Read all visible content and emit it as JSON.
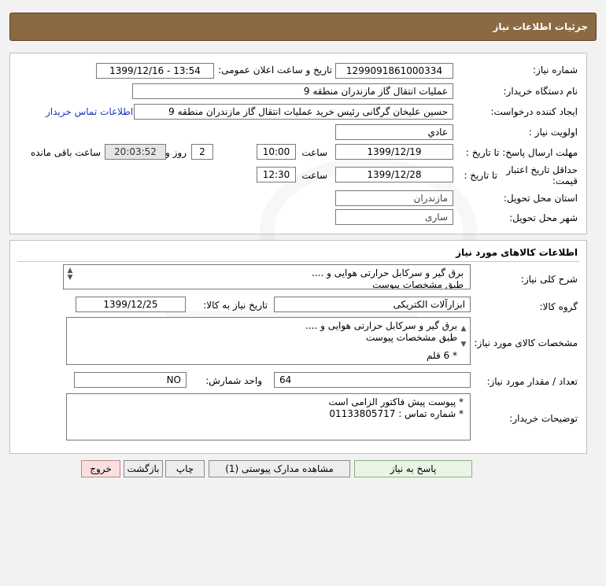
{
  "header": {
    "title": "جزئیات اطلاعات نیاز"
  },
  "fields": {
    "need_number_label": "شماره نیاز:",
    "need_number": "1299091861000334",
    "announce_label": "تاریخ و ساعت اعلان عمومی:",
    "announce_value": "1399/12/16 - 13:54",
    "buyer_org_label": "نام دستگاه خریدار:",
    "buyer_org": "عملیات انتقال گاز مازندران منطقه 9",
    "requester_label": "ایجاد کننده درخواست:",
    "requester": "حسین علیخان گرگانی رئیس خرید عملیات انتقال گاز مازندران منطقه 9",
    "contact_link": "اطلاعات تماس خریدار",
    "priority_label": "اولویت نیاز :",
    "priority": "عادي",
    "deadline_label": "مهلت ارسال پاسخ: تا تاریخ :",
    "deadline_date": "1399/12/19",
    "time_label": "ساعت",
    "deadline_time": "10:00",
    "days_value": "2",
    "days_label": "روز و",
    "remaining_time": "20:03:52",
    "remaining_label": "ساعت باقی مانده",
    "validity_label": "حداقل تاریخ اعتبار قیمت:",
    "validity_until_label": "تا تاریخ :",
    "validity_date": "1399/12/28",
    "validity_time_label": "ساعت",
    "validity_time": "12:30",
    "province_label": "استان محل تحویل:",
    "province": "مازندران",
    "city_label": "شهر محل تحویل:",
    "city": "ساری"
  },
  "goods": {
    "section_title": "اطلاعات کالاهای مورد نیاز",
    "summary_label": "شرح کلی نیاز:",
    "summary_line1": "برق گیر و سرکابل حرارتی هوایی و ....",
    "summary_line2": "طبق مشخصات پیوست",
    "group_label": "گروه کالا:",
    "group_value": "ابزارآلات الکتریکی",
    "need_date_label": "تاریخ نیاز به کالا:",
    "need_date": "1399/12/25",
    "specs_label": "مشخصات کالای مورد نیاز:",
    "specs_line1": "برق گیر و سرکابل حرارتی هوایی و ....",
    "specs_line2": "طبق مشخصات پیوست",
    "specs_line3": "* 6 قلم",
    "qty_label": "تعداد / مقدار مورد نیاز:",
    "qty_value": "64",
    "unit_label": "واحد شمارش:",
    "unit_value": "NO",
    "notes_label": "توضیحات خریدار:",
    "notes_line1": "* پیوست پیش فاکتور الزامی است",
    "notes_line2": "* شماره تماس : 01133805717"
  },
  "buttons": {
    "reply": "پاسخ به نیاز",
    "attachments": "مشاهده مدارک پیوستی (1)",
    "print": "چاپ",
    "back": "بازگشت",
    "exit": "خروج"
  },
  "colors": {
    "header_bg": "#8a6943",
    "link": "#1a35c4",
    "exit_bg": "#fbdede",
    "reply_bg": "#e8f5e4"
  },
  "icons": {
    "scroll_up": "▲",
    "scroll_down": "▼"
  }
}
